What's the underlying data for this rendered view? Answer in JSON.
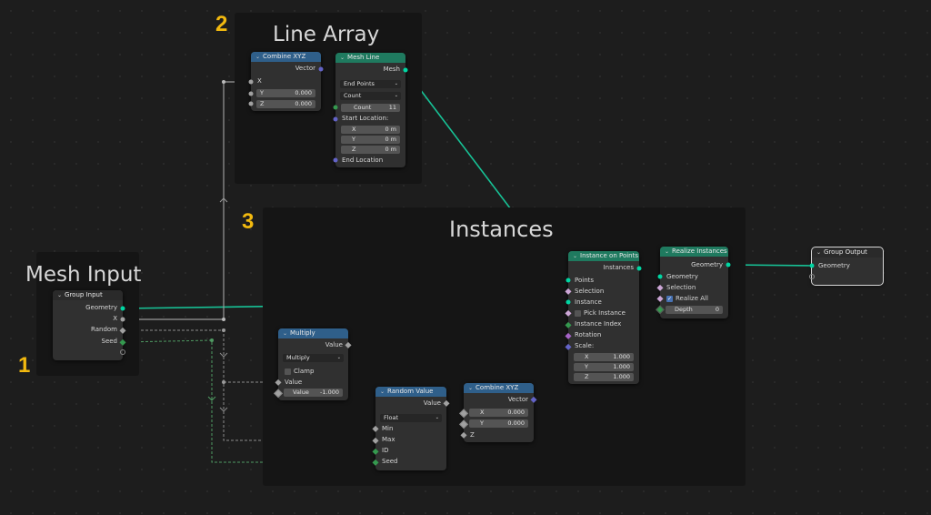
{
  "frames": {
    "line_array": {
      "title": "Line Array",
      "number": "2"
    },
    "instances": {
      "title": "Instances",
      "number": "3"
    },
    "mesh_input": {
      "title": "Mesh Input",
      "number": "1"
    }
  },
  "colors": {
    "geometry_socket": "#00d6a3",
    "vector_socket": "#6363c7",
    "float_socket": "#a1a1a1",
    "int_socket": "#35994f",
    "boolean_socket": "#cca6d6",
    "rotation_socket": "#a663c7",
    "header_blue": "#2f5f8a",
    "header_green": "#1f7a5f",
    "frame_number": "#f2b90f"
  },
  "nodes": {
    "combine_xyz_1": {
      "title": "Combine XYZ",
      "out": "Vector",
      "x": "X",
      "y_label": "Y",
      "y_val": "0.000",
      "z_label": "Z",
      "z_val": "0.000"
    },
    "mesh_line": {
      "title": "Mesh Line",
      "out": "Mesh",
      "mode": "End Points",
      "count_mode": "Count",
      "count_label": "Count",
      "count_val": "11",
      "start_label": "Start Location:",
      "sx_label": "X",
      "sx_val": "0 m",
      "sy_label": "Y",
      "sy_val": "0 m",
      "sz_label": "Z",
      "sz_val": "0 m",
      "end_label": "End Location"
    },
    "group_input": {
      "title": "Group Input",
      "geometry": "Geometry",
      "x": "X",
      "random": "Random",
      "seed": "Seed"
    },
    "multiply": {
      "title": "Multiply",
      "out": "Value",
      "op": "Multiply",
      "clamp": "Clamp",
      "in_value": "Value",
      "v_label": "Value",
      "v_val": "-1.000"
    },
    "random_value": {
      "title": "Random Value",
      "out": "Value",
      "type": "Float",
      "min": "Min",
      "max": "Max",
      "id": "ID",
      "seed": "Seed"
    },
    "combine_xyz_2": {
      "title": "Combine XYZ",
      "out": "Vector",
      "x_label": "X",
      "x_val": "0.000",
      "y_label": "Y",
      "y_val": "0.000",
      "z": "Z"
    },
    "instance_on_points": {
      "title": "Instance on Points",
      "out": "Instances",
      "points": "Points",
      "selection": "Selection",
      "instance": "Instance",
      "pick": "Pick Instance",
      "index": "Instance Index",
      "rotation": "Rotation",
      "scale": "Scale:",
      "sx_label": "X",
      "sx_val": "1.000",
      "sy_label": "Y",
      "sy_val": "1.000",
      "sz_label": "Z",
      "sz_val": "1.000"
    },
    "realize_instances": {
      "title": "Realize Instances",
      "out": "Geometry",
      "geometry": "Geometry",
      "selection": "Selection",
      "realize_all": "Realize All",
      "depth_label": "Depth",
      "depth_val": "0"
    },
    "group_output": {
      "title": "Group Output",
      "geometry": "Geometry"
    }
  }
}
